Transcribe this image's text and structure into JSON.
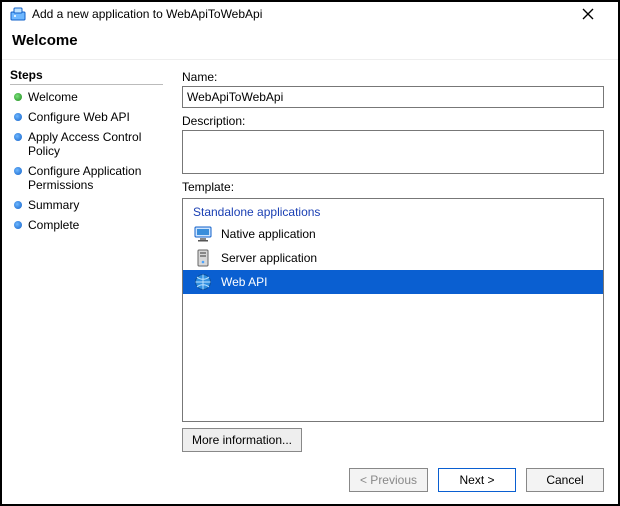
{
  "titlebar": {
    "title": "Add a new application to WebApiToWebApi"
  },
  "welcome_heading": "Welcome",
  "sidebar": {
    "heading": "Steps",
    "items": [
      {
        "label": "Welcome",
        "state": "active"
      },
      {
        "label": "Configure Web API",
        "state": "pending"
      },
      {
        "label": "Apply Access Control Policy",
        "state": "pending"
      },
      {
        "label": "Configure Application Permissions",
        "state": "pending"
      },
      {
        "label": "Summary",
        "state": "pending"
      },
      {
        "label": "Complete",
        "state": "pending"
      }
    ]
  },
  "form": {
    "name_label": "Name:",
    "name_value": "WebApiToWebApi",
    "desc_label": "Description:",
    "desc_value": "",
    "template_label": "Template:",
    "template_group": "Standalone applications",
    "templates": [
      {
        "label": "Native application",
        "icon": "monitor-icon",
        "selected": false
      },
      {
        "label": "Server application",
        "icon": "server-icon",
        "selected": false
      },
      {
        "label": "Web API",
        "icon": "globe-icon",
        "selected": true
      }
    ],
    "more_info": "More information..."
  },
  "footer": {
    "previous": "< Previous",
    "next": "Next >",
    "cancel": "Cancel"
  }
}
